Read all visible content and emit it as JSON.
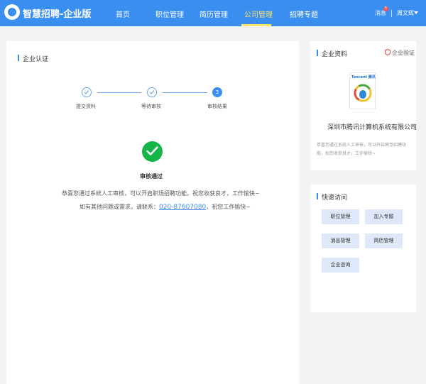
{
  "header": {
    "brand": "智慧招聘-企业版",
    "nav": [
      "首页",
      "职位管理",
      "简历管理",
      "公司管理",
      "招聘专题"
    ],
    "active_nav": "公司管理",
    "messages_label": "消息",
    "messages_badge": "5",
    "user_name": "周文辉"
  },
  "main": {
    "section_title": "企业认证",
    "steps": [
      {
        "label": "提交资料",
        "state": "done"
      },
      {
        "label": "等待审核",
        "state": "done"
      },
      {
        "label": "审核结果",
        "state": "current",
        "number": "3"
      }
    ],
    "result_title": "审核通过",
    "result_line1": "恭喜您通过系统人工审核，可以开启职场招聘功能，祝您收获良才，工作愉快~",
    "result_line2_prefix": "如有其他问题或需求，请联系：",
    "phone": "020-87607080",
    "result_line2_suffix": "，祝您工作愉快~"
  },
  "company": {
    "section_title": "企业资料",
    "verified_label": "企业验证",
    "logo_text": "Tencent 腾讯",
    "name": "深圳市腾讯计算机系统有限公司",
    "description": "恭喜您通过系统人工审核，可以开启职场招聘功能，祝您收获良才，工作愉快~"
  },
  "quick": {
    "section_title": "快速访问",
    "buttons": [
      "职位管理",
      "加入专题",
      "消息管理",
      "简历管理",
      "企业咨询"
    ]
  },
  "colors": {
    "primary": "#3a8ef0",
    "active_nav": "#ffe16b",
    "success": "#16b547",
    "quick_button": "#dfe8f8"
  }
}
